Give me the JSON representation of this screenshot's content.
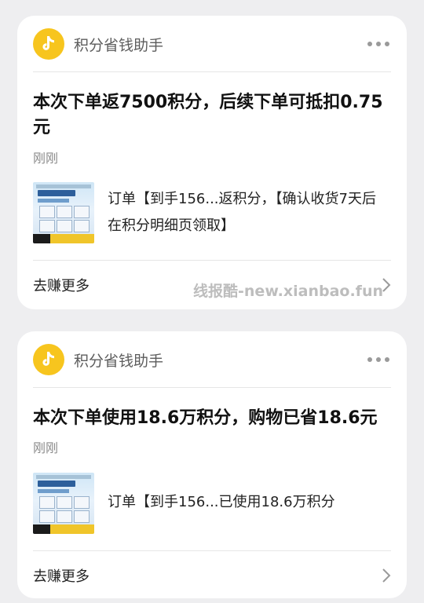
{
  "cards": [
    {
      "sender": "积分省钱助手",
      "title": "本次下单返7500积分，后续下单可抵扣0.75元",
      "time": "刚刚",
      "order_text": "订单【到手156...返积分，【确认收货7天后在积分明细页领取】",
      "footer_label": "去赚更多",
      "icons": {
        "logo": "douyin-note-icon",
        "more": "more-dots-icon",
        "chevron": "chevron-right-icon"
      }
    },
    {
      "sender": "积分省钱助手",
      "title": "本次下单使用18.6万积分，购物已省18.6元",
      "time": "刚刚",
      "order_text": "订单【到手156...已使用18.6万积分",
      "footer_label": "去赚更多",
      "icons": {
        "logo": "douyin-note-icon",
        "more": "more-dots-icon",
        "chevron": "chevron-right-icon"
      }
    }
  ],
  "watermark": "线报酷-new.xianbao.fun",
  "colors": {
    "logo_yellow": "#f7c51e",
    "background": "#eeeef0",
    "card": "#ffffff"
  }
}
